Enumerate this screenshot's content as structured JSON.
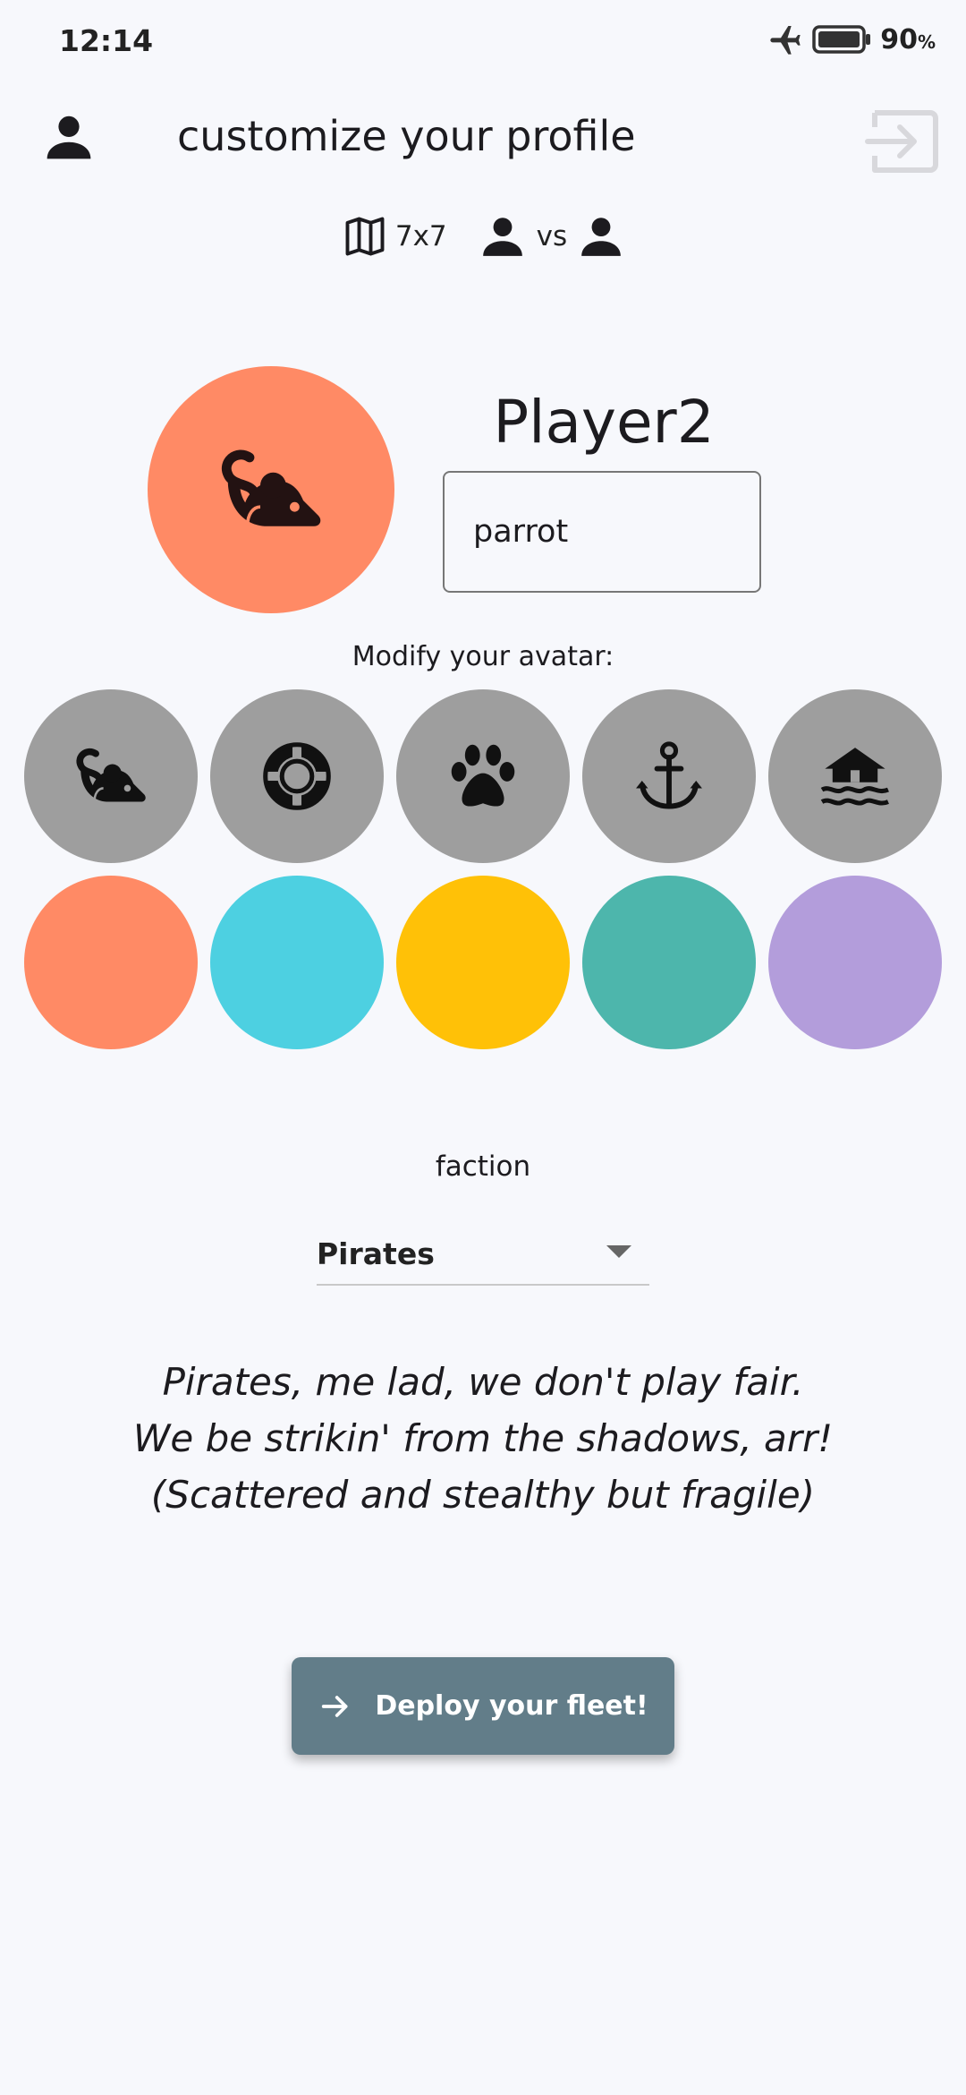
{
  "status_bar": {
    "time": "12:14",
    "battery_percent": "90",
    "battery_unit": "%",
    "icons": [
      "airplane-mode-icon",
      "battery-icon"
    ]
  },
  "header": {
    "title": "customize your profile",
    "icons": [
      "person-icon",
      "exit-icon"
    ]
  },
  "game_info": {
    "map_size": "7x7",
    "versus_label": "vs",
    "icons": [
      "map-icon",
      "person-icon",
      "person-icon"
    ]
  },
  "profile": {
    "player_name": "Player2",
    "name_input_value": "parrot",
    "avatar_icon": "rat-icon",
    "avatar_color": "#ff8a65"
  },
  "avatar_section": {
    "label": "Modify your avatar:",
    "icon_options": [
      "rat-icon",
      "life-ring-icon",
      "paw-icon",
      "anchor-icon",
      "house-flood-icon"
    ],
    "color_options": [
      "#ff8a65",
      "#4dd0e1",
      "#ffc107",
      "#4db6ac",
      "#b39ddb"
    ]
  },
  "faction": {
    "label": "faction",
    "selected": "Pirates",
    "description_lines": [
      "Pirates, me lad, we don't play fair.",
      "We be strikin' from the shadows, arr!",
      "(Scattered and stealthy but fragile)"
    ]
  },
  "deploy_button": {
    "label": "Deploy your fleet!",
    "icon": "arrow-right-icon"
  },
  "colors": {
    "background": "#f7f8fc",
    "button": "#627d89",
    "icon_option_bg": "#9e9e9e"
  }
}
